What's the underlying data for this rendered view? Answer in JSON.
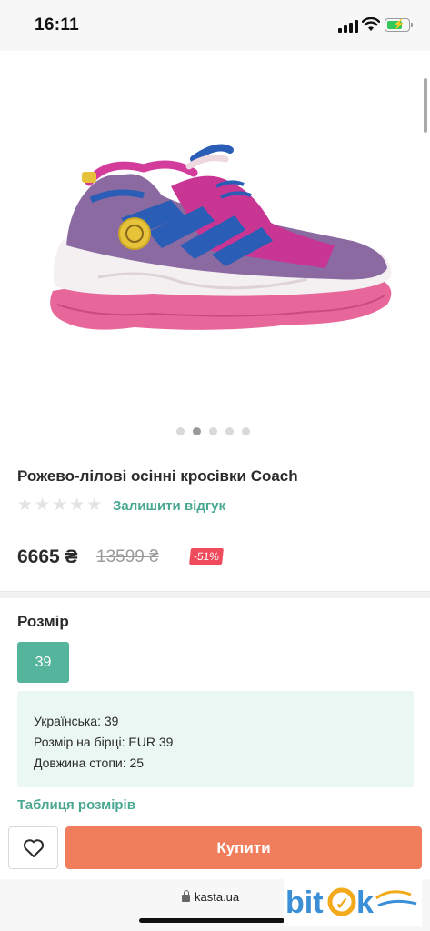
{
  "status_bar": {
    "time": "16:11",
    "battery_level": 0.75
  },
  "gallery": {
    "image_count": 5,
    "active_index": 1
  },
  "product": {
    "title": "Рожево-лілові осінні кросівки Coach",
    "rating_stars": 0,
    "rating_max": 5,
    "review_link": "Залишити відгук",
    "price": "6665 ₴",
    "old_price": "13599 ₴",
    "discount": "-51%"
  },
  "size": {
    "heading": "Розмір",
    "selected": "39",
    "info": {
      "ukrainian": "Українська: 39",
      "tag": "Розмір на бірці: EUR 39",
      "foot_length": "Довжина стопи: 25"
    },
    "table_link": "Таблиця розмірів"
  },
  "actions": {
    "buy_label": "Купити",
    "favorite_icon": "heart-icon"
  },
  "browser": {
    "url": "kasta.ua"
  },
  "watermark": {
    "text": "bitok"
  },
  "colors": {
    "accent_green": "#54b49c",
    "link_green": "#4aa892",
    "buy_orange": "#f07d5c",
    "discount_red": "#ef4b5c"
  }
}
